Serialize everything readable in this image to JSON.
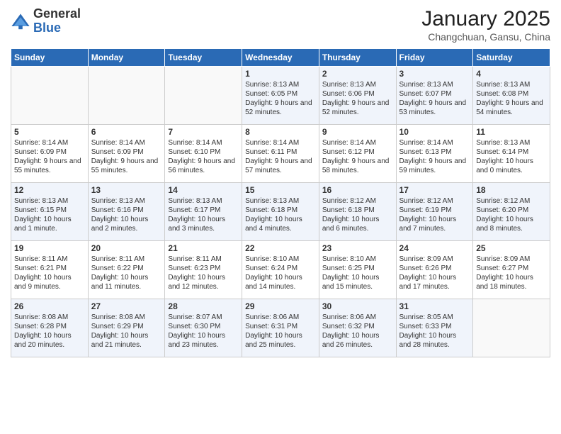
{
  "logo": {
    "general": "General",
    "blue": "Blue"
  },
  "header": {
    "title": "January 2025",
    "location": "Changchuan, Gansu, China"
  },
  "weekdays": [
    "Sunday",
    "Monday",
    "Tuesday",
    "Wednesday",
    "Thursday",
    "Friday",
    "Saturday"
  ],
  "weeks": [
    [
      {
        "day": "",
        "content": ""
      },
      {
        "day": "",
        "content": ""
      },
      {
        "day": "",
        "content": ""
      },
      {
        "day": "1",
        "content": "Sunrise: 8:13 AM\nSunset: 6:05 PM\nDaylight: 9 hours and 52 minutes."
      },
      {
        "day": "2",
        "content": "Sunrise: 8:13 AM\nSunset: 6:06 PM\nDaylight: 9 hours and 52 minutes."
      },
      {
        "day": "3",
        "content": "Sunrise: 8:13 AM\nSunset: 6:07 PM\nDaylight: 9 hours and 53 minutes."
      },
      {
        "day": "4",
        "content": "Sunrise: 8:13 AM\nSunset: 6:08 PM\nDaylight: 9 hours and 54 minutes."
      }
    ],
    [
      {
        "day": "5",
        "content": "Sunrise: 8:14 AM\nSunset: 6:09 PM\nDaylight: 9 hours and 55 minutes."
      },
      {
        "day": "6",
        "content": "Sunrise: 8:14 AM\nSunset: 6:09 PM\nDaylight: 9 hours and 55 minutes."
      },
      {
        "day": "7",
        "content": "Sunrise: 8:14 AM\nSunset: 6:10 PM\nDaylight: 9 hours and 56 minutes."
      },
      {
        "day": "8",
        "content": "Sunrise: 8:14 AM\nSunset: 6:11 PM\nDaylight: 9 hours and 57 minutes."
      },
      {
        "day": "9",
        "content": "Sunrise: 8:14 AM\nSunset: 6:12 PM\nDaylight: 9 hours and 58 minutes."
      },
      {
        "day": "10",
        "content": "Sunrise: 8:14 AM\nSunset: 6:13 PM\nDaylight: 9 hours and 59 minutes."
      },
      {
        "day": "11",
        "content": "Sunrise: 8:13 AM\nSunset: 6:14 PM\nDaylight: 10 hours and 0 minutes."
      }
    ],
    [
      {
        "day": "12",
        "content": "Sunrise: 8:13 AM\nSunset: 6:15 PM\nDaylight: 10 hours and 1 minute."
      },
      {
        "day": "13",
        "content": "Sunrise: 8:13 AM\nSunset: 6:16 PM\nDaylight: 10 hours and 2 minutes."
      },
      {
        "day": "14",
        "content": "Sunrise: 8:13 AM\nSunset: 6:17 PM\nDaylight: 10 hours and 3 minutes."
      },
      {
        "day": "15",
        "content": "Sunrise: 8:13 AM\nSunset: 6:18 PM\nDaylight: 10 hours and 4 minutes."
      },
      {
        "day": "16",
        "content": "Sunrise: 8:12 AM\nSunset: 6:18 PM\nDaylight: 10 hours and 6 minutes."
      },
      {
        "day": "17",
        "content": "Sunrise: 8:12 AM\nSunset: 6:19 PM\nDaylight: 10 hours and 7 minutes."
      },
      {
        "day": "18",
        "content": "Sunrise: 8:12 AM\nSunset: 6:20 PM\nDaylight: 10 hours and 8 minutes."
      }
    ],
    [
      {
        "day": "19",
        "content": "Sunrise: 8:11 AM\nSunset: 6:21 PM\nDaylight: 10 hours and 9 minutes."
      },
      {
        "day": "20",
        "content": "Sunrise: 8:11 AM\nSunset: 6:22 PM\nDaylight: 10 hours and 11 minutes."
      },
      {
        "day": "21",
        "content": "Sunrise: 8:11 AM\nSunset: 6:23 PM\nDaylight: 10 hours and 12 minutes."
      },
      {
        "day": "22",
        "content": "Sunrise: 8:10 AM\nSunset: 6:24 PM\nDaylight: 10 hours and 14 minutes."
      },
      {
        "day": "23",
        "content": "Sunrise: 8:10 AM\nSunset: 6:25 PM\nDaylight: 10 hours and 15 minutes."
      },
      {
        "day": "24",
        "content": "Sunrise: 8:09 AM\nSunset: 6:26 PM\nDaylight: 10 hours and 17 minutes."
      },
      {
        "day": "25",
        "content": "Sunrise: 8:09 AM\nSunset: 6:27 PM\nDaylight: 10 hours and 18 minutes."
      }
    ],
    [
      {
        "day": "26",
        "content": "Sunrise: 8:08 AM\nSunset: 6:28 PM\nDaylight: 10 hours and 20 minutes."
      },
      {
        "day": "27",
        "content": "Sunrise: 8:08 AM\nSunset: 6:29 PM\nDaylight: 10 hours and 21 minutes."
      },
      {
        "day": "28",
        "content": "Sunrise: 8:07 AM\nSunset: 6:30 PM\nDaylight: 10 hours and 23 minutes."
      },
      {
        "day": "29",
        "content": "Sunrise: 8:06 AM\nSunset: 6:31 PM\nDaylight: 10 hours and 25 minutes."
      },
      {
        "day": "30",
        "content": "Sunrise: 8:06 AM\nSunset: 6:32 PM\nDaylight: 10 hours and 26 minutes."
      },
      {
        "day": "31",
        "content": "Sunrise: 8:05 AM\nSunset: 6:33 PM\nDaylight: 10 hours and 28 minutes."
      },
      {
        "day": "",
        "content": ""
      }
    ]
  ]
}
